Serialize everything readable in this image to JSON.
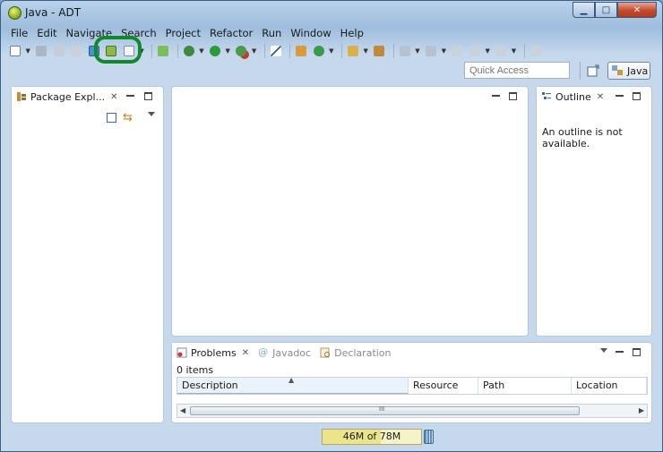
{
  "window": {
    "title": "Java - ADT",
    "min": "▁",
    "max": "□",
    "close": "✕"
  },
  "menu": [
    "File",
    "Edit",
    "Navigate",
    "Search",
    "Project",
    "Refactor",
    "Run",
    "Window",
    "Help"
  ],
  "quick_access": {
    "placeholder": "Quick Access"
  },
  "perspective": {
    "label": "Java"
  },
  "package_explorer": {
    "tab_label": "Package Expl..."
  },
  "outline": {
    "tab_label": "Outline",
    "message": "An outline is not available."
  },
  "bottom": {
    "tabs": [
      "Problems",
      "Javadoc",
      "Declaration"
    ],
    "item_count": "0 items",
    "columns": [
      "Description",
      "Resource",
      "Path",
      "Location"
    ],
    "scroll_mid": "III"
  },
  "status": {
    "memory": "46M of 78M",
    "memory_used_fraction": 0.59
  },
  "colors": {
    "highlight": "#0f8a2a",
    "accent": "#3b5f86"
  }
}
